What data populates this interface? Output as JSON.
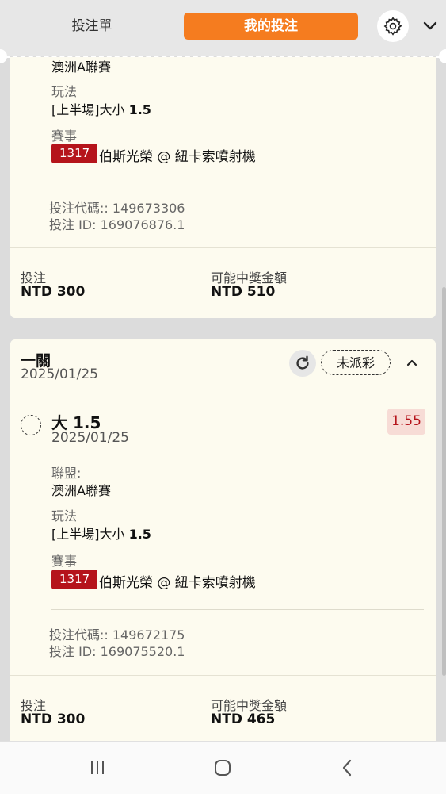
{
  "header": {
    "tab_bet_slip": "投注單",
    "tab_my_bets": "我的投注",
    "settings_icon": "gear-icon",
    "expand_icon": "chevron-down-icon"
  },
  "cards": [
    {
      "league_value": "澳洲A聯賽",
      "market_label": "玩法",
      "market_value_prefix": "[上半場]大小 ",
      "market_value_line": "1.5",
      "event_label": "賽事",
      "event_id": "1317",
      "event_name": "伯斯光榮 @ 紐卡索噴射機",
      "bet_code": "投注代碼:: 149673306",
      "bet_id": "投注 ID: 169076876.1",
      "stake_label": "投注",
      "stake_value": "NTD 300",
      "payout_label": "可能中獎金額",
      "payout_value": "NTD 510"
    },
    {
      "bet_type": "一關",
      "date": "2025/01/25",
      "status": "未派彩",
      "selection": "大 1.5",
      "selection_date": "2025/01/25",
      "odds": "1.55",
      "league_label": "聯盟:",
      "league_value": "澳洲A聯賽",
      "market_label": "玩法",
      "market_value_prefix": "[上半場]大小 ",
      "market_value_line": "1.5",
      "event_label": "賽事",
      "event_id": "1317",
      "event_name": "伯斯光榮 @ 紐卡索噴射機",
      "bet_code": "投注代碼:: 149672175",
      "bet_id": "投注 ID: 169075520.1",
      "stake_label": "投注",
      "stake_value": "NTD 300",
      "payout_label": "可能中獎金額",
      "payout_value": "NTD 465"
    }
  ],
  "colors": {
    "accent_orange": "#f57c1f",
    "badge_red": "#b5141b",
    "card_bg": "#fdfbef",
    "odds_bg": "#f7dcd6"
  },
  "navbar": {
    "recent_icon": "recent-apps-icon",
    "home_icon": "home-icon",
    "back_icon": "back-icon"
  }
}
